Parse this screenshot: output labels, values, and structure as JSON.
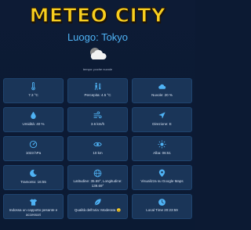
{
  "app": {
    "title": "METEO CITY",
    "location": "Luogo: Tokyo",
    "weather_description": "tempo: poche nuvole"
  },
  "cards": [
    {
      "icon": "thermometer-icon",
      "text": "7.3 °C"
    },
    {
      "icon": "person-thermometer-icon",
      "text": "Percepita: 4.5 °C"
    },
    {
      "icon": "cloud-icon",
      "text": "Nuvole: 20 %"
    },
    {
      "icon": "droplet-icon",
      "text": "Umidità: 40 %"
    },
    {
      "icon": "wind-icon",
      "text": "3.6 km/h"
    },
    {
      "icon": "direction-arrow-icon",
      "text": "Direzione: E"
    },
    {
      "icon": "gauge-icon",
      "text": "1023 hPa"
    },
    {
      "icon": "eye-icon",
      "text": "10 km"
    },
    {
      "icon": "sunrise-icon",
      "text": "Alba: 06:51"
    },
    {
      "icon": "moon-icon",
      "text": "Tramonto: 16:55"
    },
    {
      "icon": "globe-icon",
      "text": "Latitudine: 35.69°, Longitudine: 139.69°"
    },
    {
      "icon": "map-pin-icon",
      "text": "Visualizza su Google Maps"
    },
    {
      "icon": "shirt-icon",
      "text": "Indossa un cappotto pesante e accessori"
    },
    {
      "icon": "leaf-icon",
      "text": "Qualità dell'aria: Moderata 😐"
    },
    {
      "icon": "clock-icon",
      "text": "Local Time 20:23:59"
    }
  ],
  "colors": {
    "background": "#0c1a33",
    "card": "#1a3558",
    "title": "#f8cf1f",
    "location": "#4fb3f5",
    "icon": "#4fb3f5"
  }
}
